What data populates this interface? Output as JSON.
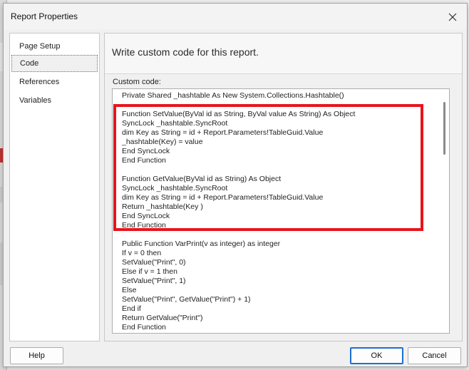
{
  "dialog": {
    "title": "Report Properties",
    "close_icon": "close-icon"
  },
  "nav": {
    "items": [
      {
        "label": "Page Setup",
        "selected": false
      },
      {
        "label": "Code",
        "selected": true
      },
      {
        "label": "References",
        "selected": false
      },
      {
        "label": "Variables",
        "selected": false
      }
    ]
  },
  "main": {
    "heading": "Write custom code for this report.",
    "code_label": "Custom code:",
    "code_lines": [
      "Private Shared _hashtable As New System.Collections.Hashtable()",
      "",
      "Function SetValue(ByVal id as String, ByVal value As String) As Object",
      "SyncLock _hashtable.SyncRoot",
      "dim Key as String = id + Report.Parameters!TableGuid.Value",
      "_hashtable(Key) = value",
      "End SyncLock",
      "End Function",
      "",
      "Function GetValue(ByVal id as String) As Object",
      "SyncLock _hashtable.SyncRoot",
      "dim Key as String = id + Report.Parameters!TableGuid.Value",
      "Return _hashtable(Key )",
      "End SyncLock",
      "End Function",
      "",
      "Public Function VarPrint(v as integer) as integer",
      "If v = 0 then",
      "SetValue(\"Print\", 0)",
      "Else if v = 1 then",
      "SetValue(\"Print\", 1)",
      "Else",
      "SetValue(\"Print\", GetValue(\"Print\") + 1)",
      "End if",
      "Return GetValue(\"Print\")",
      "End Function"
    ],
    "highlight_color": "#e8141b"
  },
  "footer": {
    "help_label": "Help",
    "ok_label": "OK",
    "cancel_label": "Cancel"
  },
  "colors": {
    "primary_border": "#1a6fd1"
  }
}
